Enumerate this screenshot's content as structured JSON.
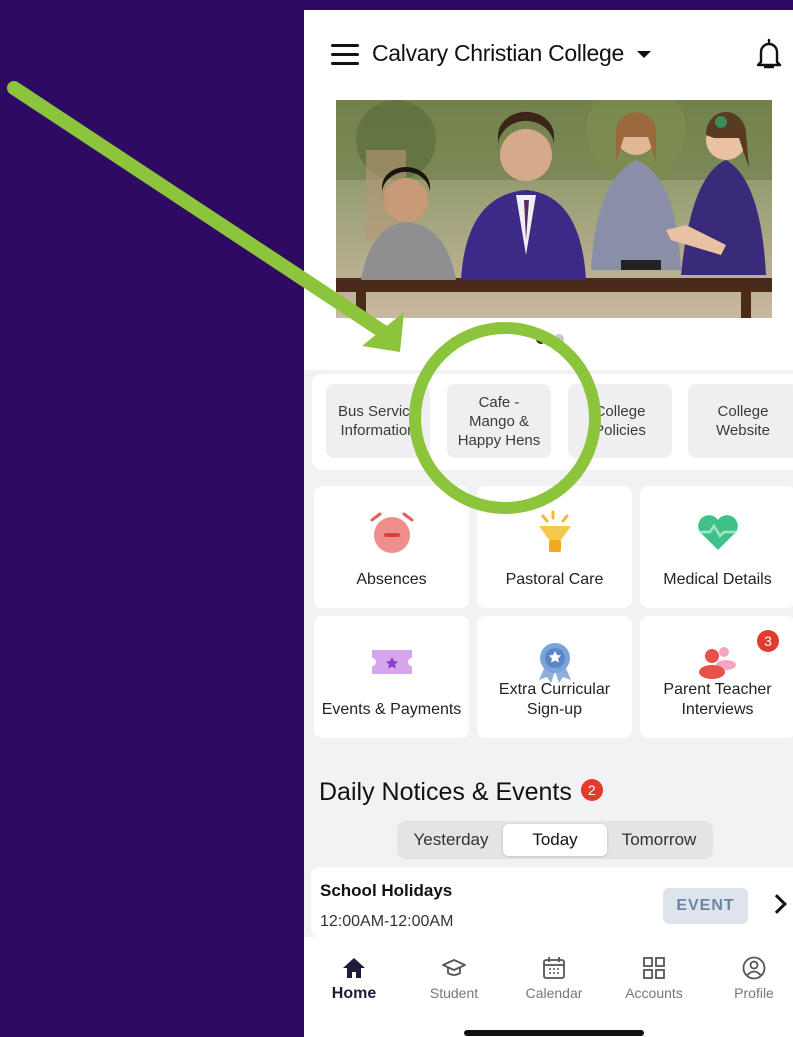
{
  "header": {
    "school_name": "Calvary Christian College"
  },
  "banner": {
    "dot_count": 2,
    "active_dot": 0
  },
  "quick_links": [
    {
      "label": "Bus Service\nInformation"
    },
    {
      "label": "Cafe -\nMango &\nHappy Hens"
    },
    {
      "label": "College\nPolicies"
    },
    {
      "label": "College\nWebsite"
    }
  ],
  "tiles": [
    {
      "label": "Absences",
      "icon": "alarm-clock-icon"
    },
    {
      "label": "Pastoral Care",
      "icon": "lamp-icon"
    },
    {
      "label": "Medical Details",
      "icon": "heart-icon"
    },
    {
      "label": "Events & Payments",
      "icon": "ticket-icon"
    },
    {
      "label": "Extra Curricular\nSign-up",
      "icon": "award-ribbon-icon"
    },
    {
      "label": "Parent Teacher\nInterviews",
      "icon": "people-icon",
      "badge": "3"
    }
  ],
  "notices": {
    "title": "Daily Notices & Events",
    "badge": "2",
    "segments": [
      "Yesterday",
      "Today",
      "Tomorrow"
    ],
    "selected_segment": "Today",
    "events": [
      {
        "title": "School Holidays",
        "time": "12:00AM-12:00AM",
        "tag": "EVENT"
      }
    ]
  },
  "tabbar": [
    {
      "label": "Home",
      "icon": "home-icon",
      "active": true
    },
    {
      "label": "Student",
      "icon": "graduation-cap-icon",
      "active": false
    },
    {
      "label": "Calendar",
      "icon": "calendar-icon",
      "active": false
    },
    {
      "label": "Accounts",
      "icon": "grid-icon",
      "active": false
    },
    {
      "label": "Profile",
      "icon": "user-circle-icon",
      "active": false
    }
  ],
  "colors": {
    "page_background": "#2e0a62",
    "annotation_green": "#8cc43c",
    "badge_red": "#e23a2d",
    "event_tag_bg": "#dfe4ec"
  }
}
